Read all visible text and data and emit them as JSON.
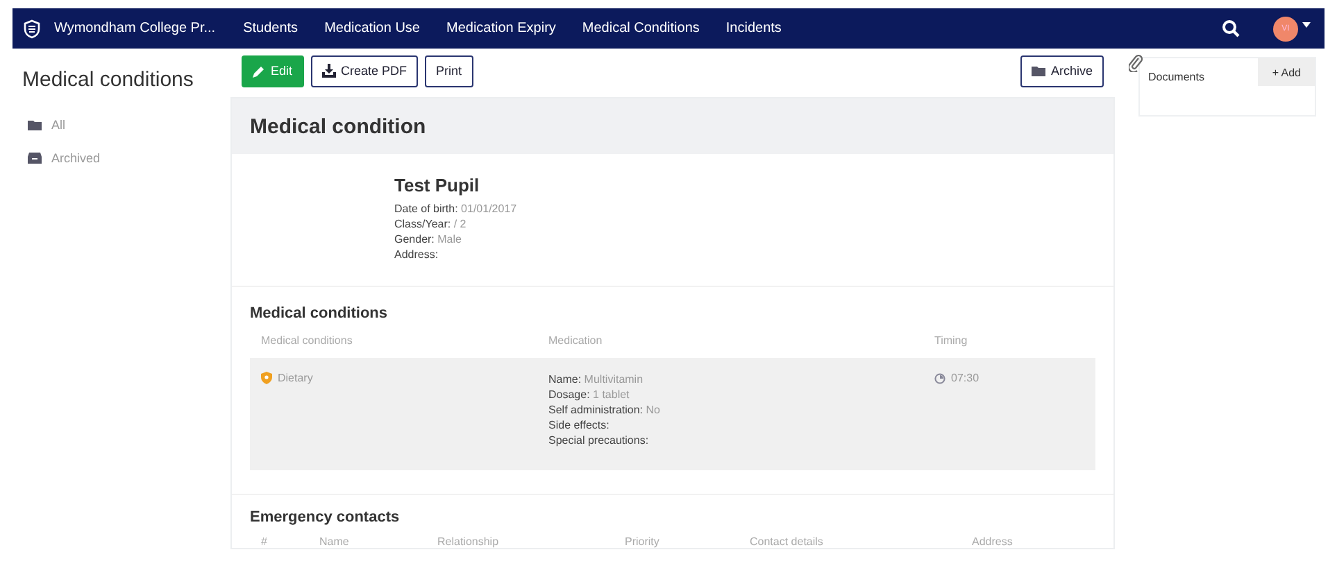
{
  "nav": {
    "brand": "Wymondham College Pr...",
    "items": [
      "Students",
      "Medication Use",
      "Medication Expiry",
      "Medical Conditions",
      "Incidents"
    ],
    "avatar": "VI"
  },
  "sidebar": {
    "title": "Medical conditions",
    "items": [
      {
        "label": "All",
        "kind": "folder"
      },
      {
        "label": "Archived",
        "kind": "archive"
      }
    ]
  },
  "toolbar": {
    "edit": "Edit",
    "pdf": "Create PDF",
    "print": "Print",
    "archive": "Archive"
  },
  "card": {
    "title": "Medical condition",
    "pupil": {
      "name": "Test Pupil",
      "fields": [
        {
          "label": "Date of birth:",
          "value": "01/01/2017"
        },
        {
          "label": "Class/Year:",
          "value": "/ 2"
        },
        {
          "label": "Gender:",
          "value": "Male"
        },
        {
          "label": "Address:"
        }
      ]
    },
    "conditions": {
      "title": "Medical conditions",
      "columns": [
        "Medical conditions",
        "Medication",
        "Timing"
      ],
      "rows": [
        {
          "condition": "Dietary",
          "medication": [
            {
              "label": "Name:",
              "value": "Multivitamin"
            },
            {
              "label": "Dosage:",
              "value": "1 tablet"
            },
            {
              "label": "Self administration:",
              "value": "No"
            },
            {
              "label": "Side effects:"
            },
            {
              "label": "Special precautions:"
            }
          ],
          "timing": "07:30"
        }
      ]
    },
    "contacts": {
      "title": "Emergency contacts",
      "columns": [
        "#",
        "Name",
        "Relationship",
        "Priority",
        "Contact details",
        "Address"
      ]
    }
  },
  "documents": {
    "title": "Documents",
    "add": "+ Add"
  }
}
